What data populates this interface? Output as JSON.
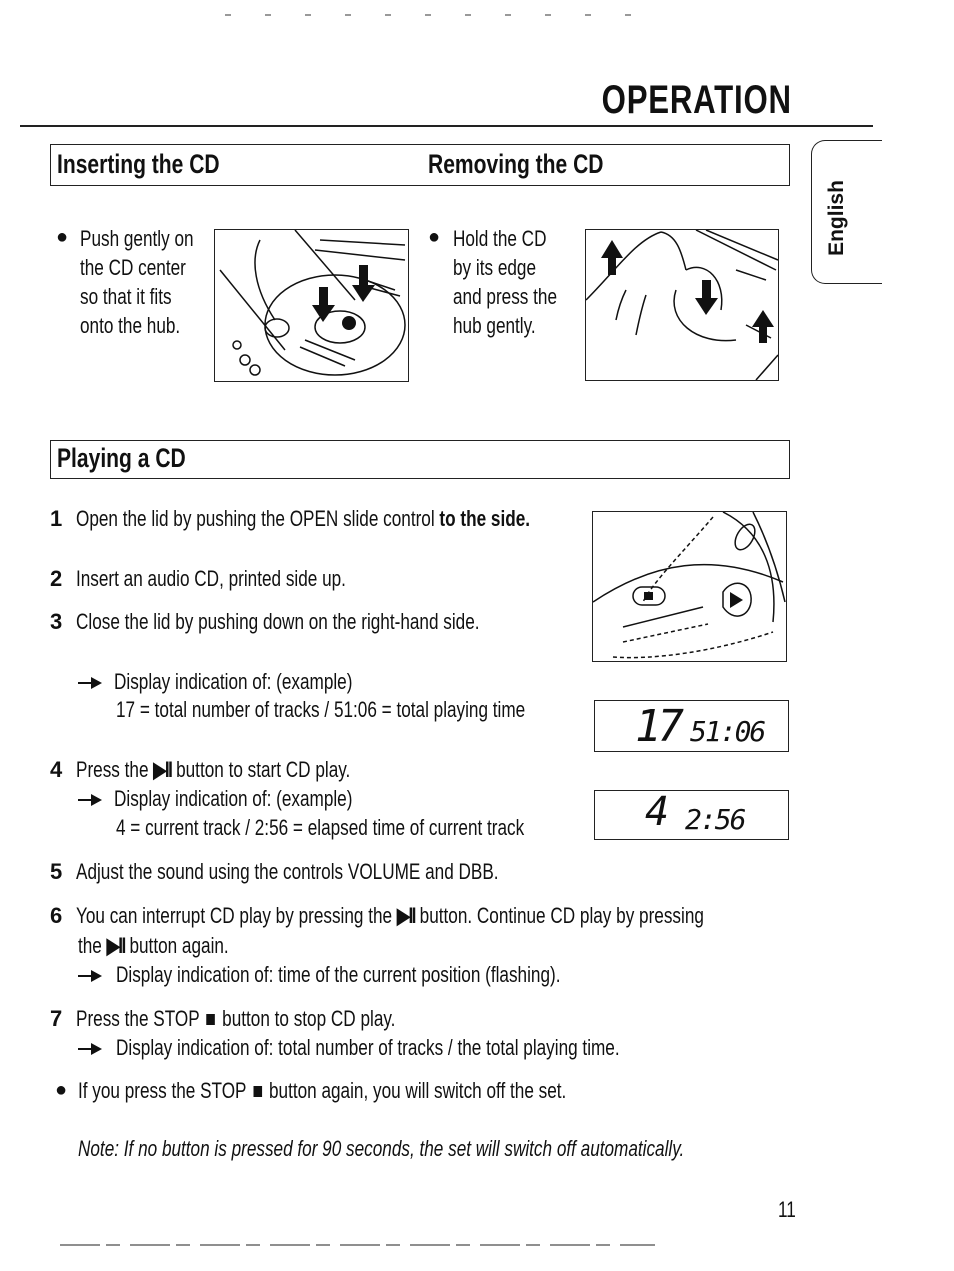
{
  "header": {
    "title": "OPERATION",
    "language_tab": "English"
  },
  "sections": {
    "inserting": {
      "title": "Inserting the CD",
      "bullet_lines": [
        "Push gently on",
        "the CD center",
        "so that it fits",
        "onto the hub."
      ],
      "illustration": "finger-pressing-cd-hub-illustration"
    },
    "removing": {
      "title": "Removing the CD",
      "bullet_lines": [
        "Hold the CD",
        "by its edge",
        "and press the",
        "hub gently."
      ],
      "illustration": "hand-lifting-cd-illustration"
    },
    "playing": {
      "title": "Playing a CD",
      "steps": [
        {
          "num": "1",
          "text_plain": "Open the lid by pushing the OPEN slide control ",
          "text_bold": "to the side."
        },
        {
          "num": "2",
          "text": "Insert an audio CD, printed side up."
        },
        {
          "num": "3",
          "text": "Close the lid by pushing down on the right-hand side.",
          "result": "Display indication of: (example)",
          "result_detail": "17 = total number of tracks / 51:06 = total playing time"
        },
        {
          "num": "4",
          "text_before": "Press the ",
          "icon": "▶II",
          "text_after": " button to start CD play.",
          "result": "Display indication of: (example)",
          "result_detail": "4 = current track / 2:56 = elapsed time of current track"
        },
        {
          "num": "5",
          "text": "Adjust the sound using the controls VOLUME and DBB."
        },
        {
          "num": "6",
          "text_a": "You can interrupt CD play by pressing the ",
          "icon": "▶II",
          "text_b": " button. Continue CD play by pressing",
          "line2_a": "the ",
          "line2_b": " button again.",
          "result": "Display indication of: time of the current position (flashing)."
        },
        {
          "num": "7",
          "text_a": "Press the STOP ",
          "text_b": " button to stop CD play.",
          "result": "Display indication of: total number of tracks / the total playing time."
        }
      ],
      "bullet_after": {
        "text_a": "If you press the STOP ",
        "text_b": " button again, you will switch off the set."
      },
      "note": "Note: If no button is pressed for 90 seconds, the set will switch off automatically.",
      "lcd_displays": [
        {
          "track": "17",
          "time": "51:06",
          "label": "total tracks / total playing time"
        },
        {
          "track": "4",
          "time": "2:56",
          "label": "current track / elapsed time"
        }
      ],
      "device_labels": {
        "open": "OPEN",
        "play_pause": "PLAY/ PAUSE"
      }
    }
  },
  "footer": {
    "page_number": "11"
  }
}
